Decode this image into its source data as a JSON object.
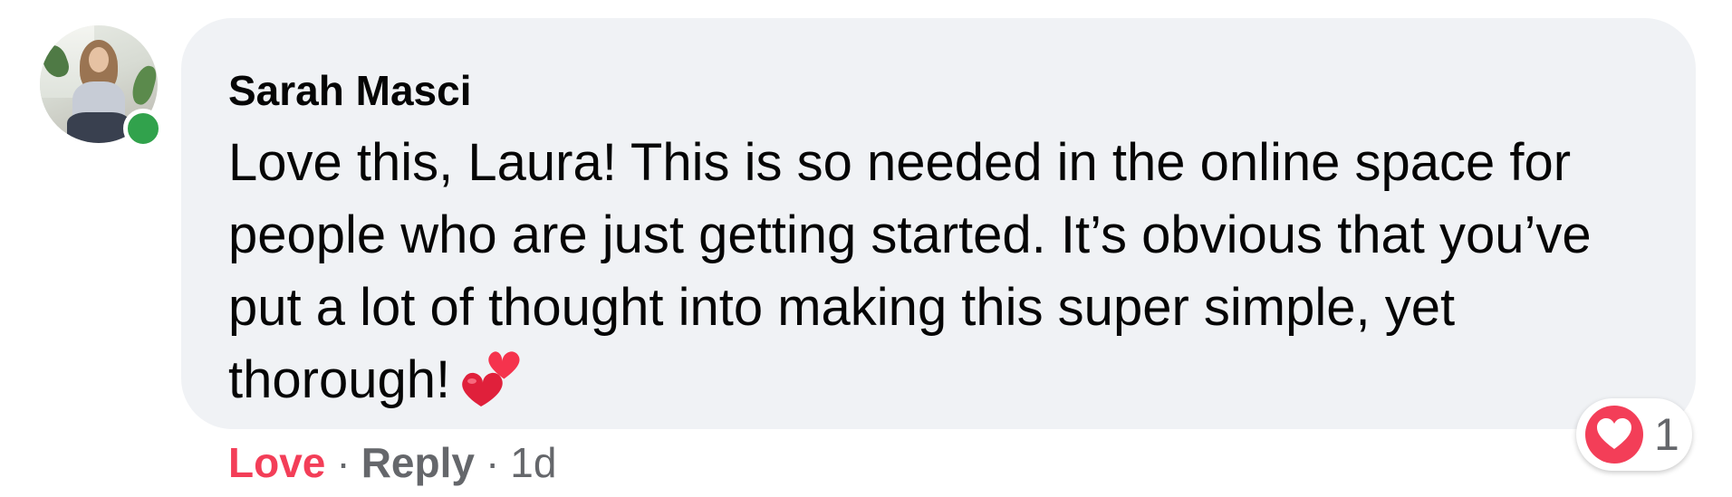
{
  "comment": {
    "author": "Sarah Masci",
    "text": "Love this, Laura! This is so needed in the online space for people who are just getting started. It’s obvious that you’ve put a lot of thought into making this super simple, yet thorough!",
    "emoji": "two-hearts-icon",
    "online": true
  },
  "actions": {
    "love_label": "Love",
    "reply_label": "Reply",
    "separator": "·",
    "timestamp": "1d"
  },
  "reactions": {
    "icon": "love-reaction-icon",
    "count": "1"
  },
  "colors": {
    "bubble": "#f0f2f5",
    "love": "#f33e58",
    "meta": "#65676b",
    "online": "#31a24c",
    "text": "#050505"
  }
}
